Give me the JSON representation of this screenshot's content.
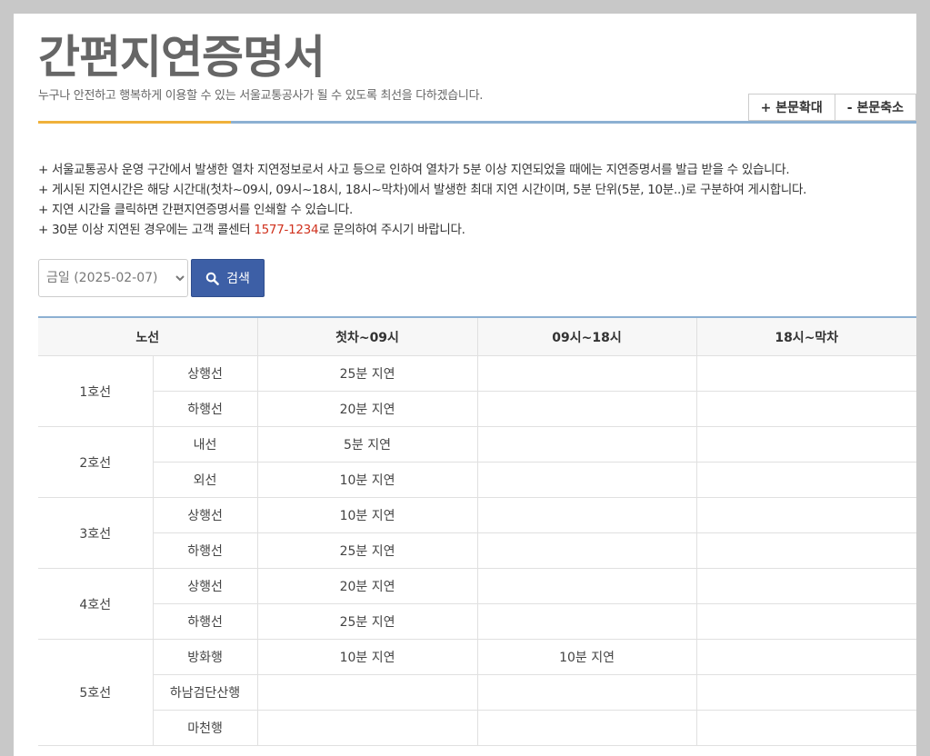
{
  "header": {
    "title": "간편지연증명서",
    "subtitle": "누구나 안전하고 행복하게 이용할 수 있는 서울교통공사가 될 수 있도록 최선을 다하겠습니다.",
    "zoom_in_label": "+ 본문확대",
    "zoom_out_label": "- 본문축소"
  },
  "notes": [
    "+ 서울교통공사 운영 구간에서 발생한 열차 지연정보로서 사고 등으로 인하여 열차가 5분 이상 지연되었을 때에는 지연증명서를 발급 받을 수 있습니다.",
    "+ 게시된 지연시간은 해당 시간대(첫차~09시, 09시~18시, 18시~막차)에서 발생한 최대 지연 시간이며, 5분 단위(5분, 10분..)로 구분하여 게시합니다.",
    "+ 지연 시간을 클릭하면 간편지연증명서를 인쇄할 수 있습니다."
  ],
  "note_contact": {
    "before": "+ 30분 이상 지연된 경우에는 고객 콜센터 ",
    "phone": "1577-1234",
    "after": "로 문의하여 주시기 바랍니다."
  },
  "search": {
    "date_selected": "금일 (2025-02-07)",
    "button_label": "검색"
  },
  "table": {
    "headers": [
      "노선",
      "첫차~09시",
      "09시~18시",
      "18시~막차"
    ],
    "lines": [
      {
        "name": "1호선",
        "rows": [
          {
            "dir": "상행선",
            "t1": "25분 지연",
            "t2": "",
            "t3": ""
          },
          {
            "dir": "하행선",
            "t1": "20분 지연",
            "t2": "",
            "t3": ""
          }
        ]
      },
      {
        "name": "2호선",
        "rows": [
          {
            "dir": "내선",
            "t1": "5분 지연",
            "t2": "",
            "t3": ""
          },
          {
            "dir": "외선",
            "t1": "10분 지연",
            "t2": "",
            "t3": ""
          }
        ]
      },
      {
        "name": "3호선",
        "rows": [
          {
            "dir": "상행선",
            "t1": "10분 지연",
            "t2": "",
            "t3": ""
          },
          {
            "dir": "하행선",
            "t1": "25분 지연",
            "t2": "",
            "t3": ""
          }
        ]
      },
      {
        "name": "4호선",
        "rows": [
          {
            "dir": "상행선",
            "t1": "20분 지연",
            "t2": "",
            "t3": ""
          },
          {
            "dir": "하행선",
            "t1": "25분 지연",
            "t2": "",
            "t3": ""
          }
        ]
      },
      {
        "name": "5호선",
        "rows": [
          {
            "dir": "방화행",
            "t1": "10분 지연",
            "t2": "10분 지연",
            "t3": ""
          },
          {
            "dir": "하남검단산행",
            "t1": "",
            "t2": "",
            "t3": ""
          },
          {
            "dir": "마천행",
            "t1": "",
            "t2": "",
            "t3": ""
          }
        ]
      }
    ]
  },
  "colors": {
    "accent_orange": "#f0b13a",
    "accent_blue_line": "#8cb0d2",
    "search_button": "#3d5fa6",
    "phone_red": "#d0321e"
  }
}
